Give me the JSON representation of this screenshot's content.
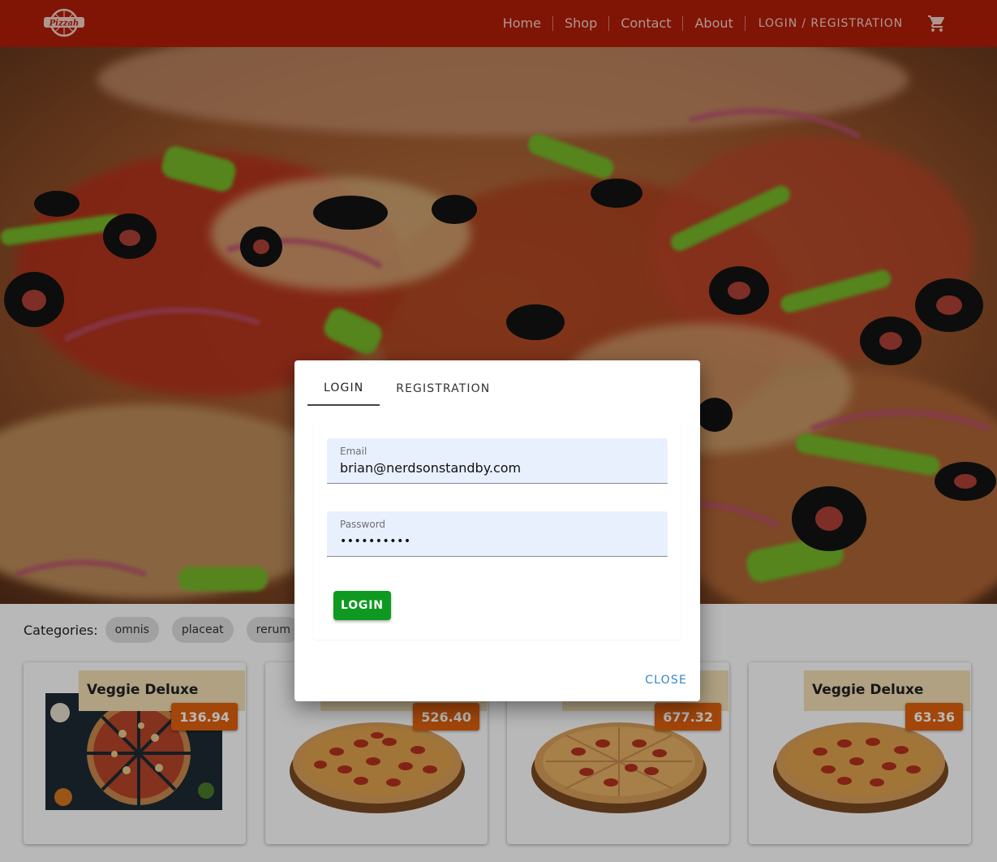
{
  "header": {
    "logo_text": "Pizzah",
    "nav": [
      {
        "label": "Home"
      },
      {
        "label": "Shop"
      },
      {
        "label": "Contact"
      },
      {
        "label": "About"
      },
      {
        "label": "LOGIN / REGISTRATION"
      }
    ],
    "cart_icon": "shopping-cart-icon"
  },
  "categories": {
    "label": "Categories:",
    "items": [
      "omnis",
      "placeat",
      "rerum"
    ]
  },
  "products": [
    {
      "name": "Veggie Deluxe",
      "price": "136.94"
    },
    {
      "name": "",
      "price": "526.40"
    },
    {
      "name": "",
      "price": "677.32"
    },
    {
      "name": "Veggie Deluxe",
      "price": "63.36"
    }
  ],
  "dialog": {
    "tabs": [
      {
        "label": "LOGIN",
        "active": true
      },
      {
        "label": "REGISTRATION",
        "active": false
      }
    ],
    "email": {
      "label": "Email",
      "value": "brian@nerdsonstandby.com"
    },
    "password": {
      "label": "Password",
      "value": "••••••••••"
    },
    "login_button": "LOGIN",
    "close_button": "CLOSE"
  },
  "colors": {
    "header": "#b21e07",
    "price_badge": "#e1620f",
    "login_button": "#0e9a21",
    "close_link": "#2e89c9",
    "title_banner": "#f3dfb4",
    "input_fill": "#e8f0fe"
  }
}
